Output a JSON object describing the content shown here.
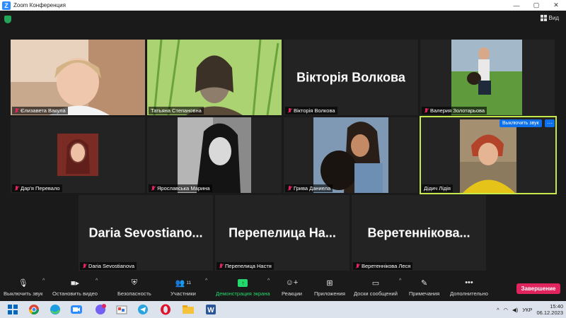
{
  "window": {
    "title": "Zoom Конференция",
    "controls": [
      "—",
      "▢",
      "✕"
    ]
  },
  "topbar": {
    "view_label": "Вид"
  },
  "colors": {
    "active_speaker": "#c5e84b",
    "mute_red": "#e0245e",
    "end_red": "#e0245e",
    "accent_blue": "#0e71eb",
    "share_green": "#23d96b"
  },
  "tiles": [
    {
      "name": "Єлизавета Вакула",
      "muted": true
    },
    {
      "name": "Татьяна Степановна",
      "muted": false
    },
    {
      "name": "Вікторія Волкова",
      "muted": true,
      "big": "Вікторія Волкова"
    },
    {
      "name": "Валерия Золотарьова",
      "muted": true
    },
    {
      "name": "Дар'я Перевало",
      "muted": true
    },
    {
      "name": "Ярославська Марина",
      "muted": true
    },
    {
      "name": "Грива Даниела",
      "muted": true
    },
    {
      "name": "Дідич Лідія",
      "muted": false,
      "active": true
    },
    {
      "name": "Daria Sevostianova",
      "muted": true,
      "big": "Daria  Sevostiano..."
    },
    {
      "name": "Перепелица Настя",
      "muted": true,
      "big": "Перепелица  На..."
    },
    {
      "name": "Веретеннікова Леся",
      "muted": true,
      "big": "Веретеннікова..."
    }
  ],
  "active_controls": {
    "unmute": "Выключить звук",
    "more": "···"
  },
  "toolbar": {
    "mute": "Выключить звук",
    "video": "Остановить видео",
    "security": "Безопасность",
    "participants": "Участники",
    "participants_count": "11",
    "share": "Демонстрация экрана",
    "reactions": "Реакции",
    "apps": "Приложения",
    "whiteboards": "Доски сообщений",
    "notes": "Примечания",
    "more": "Дополнительно",
    "end": "Завершение"
  },
  "taskbar": {
    "icons": [
      "windows-start",
      "chrome",
      "edge",
      "zoom",
      "viber",
      "paint",
      "telegram",
      "opera",
      "file-explorer",
      "word"
    ],
    "lang": "УКР",
    "time": "15:40",
    "date": "06.12.2023"
  }
}
